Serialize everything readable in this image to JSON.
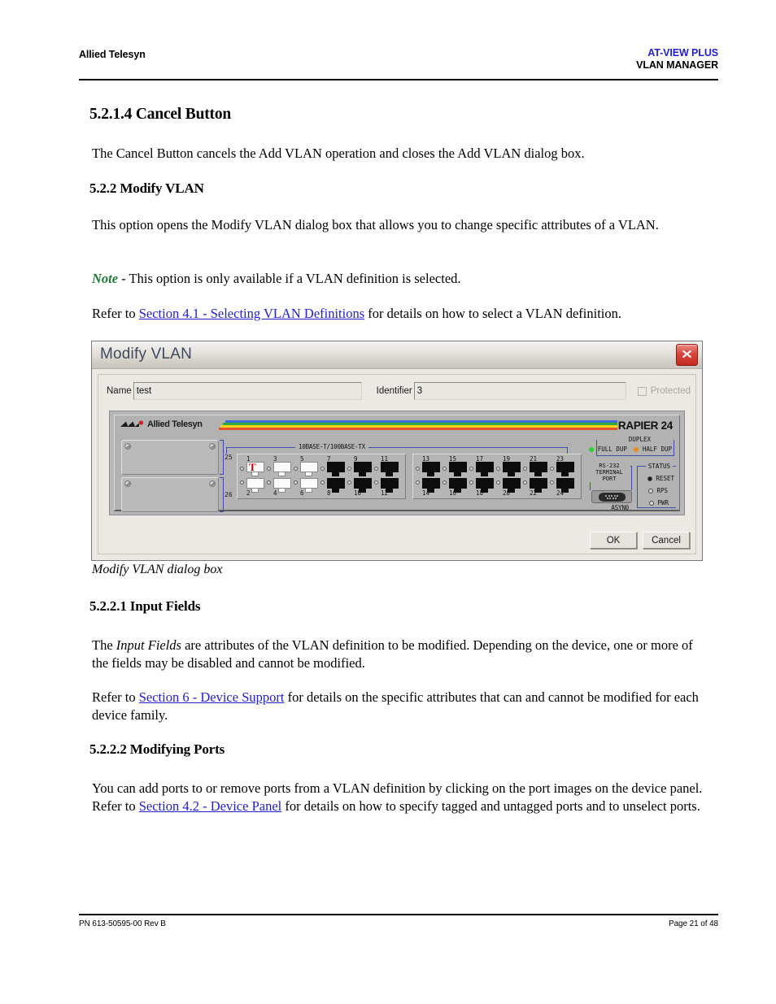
{
  "header": {
    "brand": "Allied Telesyn",
    "product_line1": "AT-VIEW PLUS",
    "product_line2": "VLAN MANAGER"
  },
  "footer": {
    "part_number": "PN 613-50595-00 Rev B",
    "page": "Page 21 of 48"
  },
  "sections": {
    "cancel_button_heading": "5.2.1.4 Cancel Button",
    "cancel_button_para": "The Cancel Button cancels the Add VLAN operation and closes the Add VLAN dialog box.",
    "modify_vlan_heading": "5.2.2 Modify VLAN",
    "modify_vlan_para": "This option opens the Modify VLAN dialog box that allows you to change specific attributes of a VLAN.",
    "note_word": "Note",
    "note_text": " - This option is only available if a VLAN definition is selected.",
    "refer_prefix_1": "Refer to ",
    "refer_link_1": "Section 4.1 - Selecting VLAN Definitions",
    "refer_suffix_1": " for details on how to select a VLAN definition.",
    "figure_caption": "Modify VLAN dialog box",
    "input_fields_heading": "5.2.2.1 Input Fields",
    "input_fields_para_a": "The ",
    "input_fields_para_em": "Input Fields",
    "input_fields_para_b": " are attributes of the VLAN definition to be modified. Depending on the device, one or more of the fields may be disabled and cannot be modified.",
    "refer_prefix_2": "Refer to ",
    "refer_link_2": "Section 6 - Device Support",
    "refer_suffix_2": " for details on the specific attributes that can and cannot be modified for each device family.",
    "modifying_ports_heading": "5.2.2.2 Modifying Ports",
    "modifying_ports_a": "You can add ports to or remove ports from a VLAN definition by clicking on the port images on the device panel. Refer to ",
    "modifying_ports_link": "Section 4.2 - Device Panel",
    "modifying_ports_b": " for details on how to specify tagged and untagged ports and to unselect ports."
  },
  "dialog": {
    "title": "Modify VLAN",
    "close_icon": "close-icon",
    "fields": {
      "name_label": "Name",
      "name_value": "test",
      "identifier_label": "Identifier",
      "identifier_value": "3",
      "protected_label": "Protected",
      "protected_checked": false,
      "protected_disabled": true
    },
    "buttons": {
      "ok": "OK",
      "cancel": "Cancel"
    },
    "device_panel": {
      "vendor": "Allied Telesyn",
      "model": "RAPIER 24",
      "stripe_colors": [
        "#3a6fd8",
        "#36a83a",
        "#f2d21a",
        "#e0552e"
      ],
      "uplink_bays": [
        {
          "number": "25"
        },
        {
          "number": "26"
        }
      ],
      "ports_label": "10BASE-T/100BASE-TX",
      "port_group_1": [
        {
          "top": "1",
          "bottom": "2",
          "top_state": "selected",
          "bottom_state": "selected",
          "tagged_top": true,
          "tag_mark": "T"
        },
        {
          "top": "3",
          "bottom": "4",
          "top_state": "selected",
          "bottom_state": "selected",
          "tagged_top": false,
          "tag_mark": ""
        },
        {
          "top": "5",
          "bottom": "6",
          "top_state": "selected",
          "bottom_state": "selected",
          "tagged_top": false,
          "tag_mark": ""
        },
        {
          "top": "7",
          "bottom": "8",
          "top_state": "unselected",
          "bottom_state": "unselected",
          "tagged_top": false,
          "tag_mark": ""
        },
        {
          "top": "9",
          "bottom": "10",
          "top_state": "unselected",
          "bottom_state": "unselected",
          "tagged_top": false,
          "tag_mark": ""
        },
        {
          "top": "11",
          "bottom": "12",
          "top_state": "unselected",
          "bottom_state": "unselected",
          "tagged_top": false,
          "tag_mark": ""
        }
      ],
      "port_group_2": [
        {
          "top": "13",
          "bottom": "14",
          "top_state": "unselected",
          "bottom_state": "unselected",
          "tagged_top": false,
          "tag_mark": ""
        },
        {
          "top": "15",
          "bottom": "16",
          "top_state": "unselected",
          "bottom_state": "unselected",
          "tagged_top": false,
          "tag_mark": ""
        },
        {
          "top": "17",
          "bottom": "18",
          "top_state": "unselected",
          "bottom_state": "unselected",
          "tagged_top": false,
          "tag_mark": ""
        },
        {
          "top": "19",
          "bottom": "20",
          "top_state": "unselected",
          "bottom_state": "unselected",
          "tagged_top": false,
          "tag_mark": ""
        },
        {
          "top": "21",
          "bottom": "22",
          "top_state": "unselected",
          "bottom_state": "unselected",
          "tagged_top": false,
          "tag_mark": ""
        },
        {
          "top": "23",
          "bottom": "24",
          "top_state": "unselected",
          "bottom_state": "unselected",
          "tagged_top": false,
          "tag_mark": ""
        }
      ],
      "duplex": {
        "title": "DUPLEX",
        "full_label": "FULL DUP",
        "full_color": "#2fd22f",
        "half_label": "HALF DUP",
        "half_color": "#ef8a12"
      },
      "serial": {
        "title_line1": "RS-232",
        "title_line2": "TERMINAL",
        "title_line3": "PORT",
        "connector_label": "ASYN0"
      },
      "status": {
        "title": "STATUS",
        "items": [
          {
            "label": "RESET",
            "state": "on"
          },
          {
            "label": "RPS",
            "state": "off"
          },
          {
            "label": "PWR",
            "state": "off"
          }
        ]
      }
    }
  }
}
